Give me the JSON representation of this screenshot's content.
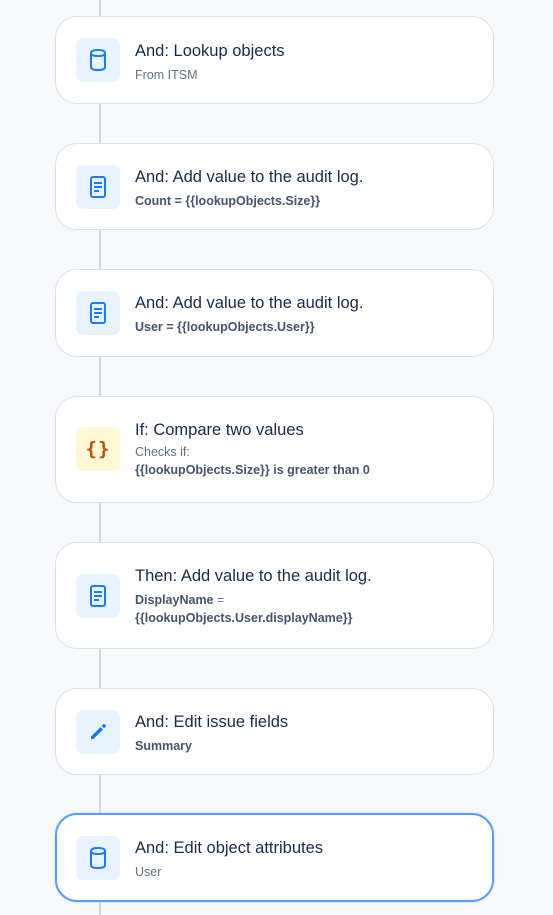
{
  "steps": [
    {
      "title": "And: Lookup objects",
      "sub": "From ITSM",
      "icon": "database-icon"
    },
    {
      "title": "And: Add value to the audit log.",
      "key": "Count",
      "rest": " = {{lookupObjects.Size}}",
      "icon": "document-icon"
    },
    {
      "title": "And: Add value to the audit log.",
      "key": "User",
      "rest": " = {{lookupObjects.User}}",
      "icon": "document-icon"
    },
    {
      "title": "If: Compare two values",
      "checks_label": "Checks if:",
      "condition": "{{lookupObjects.Size}} is greater than 0",
      "icon": "braces-icon",
      "icon_glyph": "{}"
    },
    {
      "title": "Then: Add value to the audit log.",
      "key": "DisplayName",
      "rest": " =",
      "line2": "{{lookupObjects.User.displayName}}",
      "icon": "document-icon"
    },
    {
      "title": "And: Edit issue fields",
      "key": "Summary",
      "icon": "pencil-icon"
    },
    {
      "title": "And: Edit object attributes",
      "sub": "User",
      "icon": "database-icon",
      "selected": true
    }
  ],
  "colors": {
    "accent": "#579dff",
    "icon_blue": "#1d7afc",
    "icon_yellow": "#c25100",
    "title": "#172b4d",
    "subtitle": "#626f86"
  }
}
